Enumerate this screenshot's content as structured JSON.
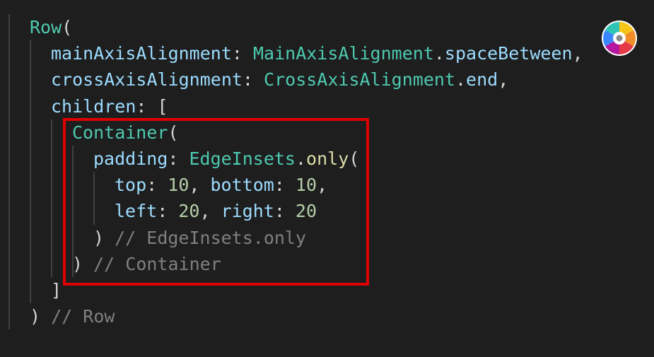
{
  "editor": {
    "background": "#1e1e1e",
    "token_colors": {
      "class": "#4ec9b0",
      "property": "#9cdcfe",
      "function": "#dcdcaa",
      "number": "#b5cea8",
      "punctuation": "#d4d4d4",
      "comment": "#808080",
      "bracket": "#ffd700"
    },
    "lines": [
      {
        "indent": 0,
        "tokens": [
          {
            "t": "Row",
            "k": "class"
          },
          {
            "t": "(",
            "k": "punctuation"
          }
        ]
      },
      {
        "indent": 1,
        "tokens": [
          {
            "t": "mainAxisAlignment",
            "k": "property"
          },
          {
            "t": ": ",
            "k": "punctuation"
          },
          {
            "t": "MainAxisAlignment",
            "k": "class"
          },
          {
            "t": ".",
            "k": "punctuation"
          },
          {
            "t": "spaceBetween",
            "k": "property"
          },
          {
            "t": ",",
            "k": "punctuation"
          }
        ]
      },
      {
        "indent": 1,
        "tokens": [
          {
            "t": "crossAxisAlignment",
            "k": "property"
          },
          {
            "t": ": ",
            "k": "punctuation"
          },
          {
            "t": "CrossAxisAlignment",
            "k": "class"
          },
          {
            "t": ".",
            "k": "punctuation"
          },
          {
            "t": "end",
            "k": "property"
          },
          {
            "t": ",",
            "k": "punctuation"
          }
        ]
      },
      {
        "indent": 1,
        "tokens": [
          {
            "t": "children",
            "k": "property"
          },
          {
            "t": ": [",
            "k": "punctuation"
          }
        ]
      },
      {
        "indent": 2,
        "tokens": [
          {
            "t": "Container",
            "k": "class"
          },
          {
            "t": "(",
            "k": "punctuation"
          }
        ]
      },
      {
        "indent": 3,
        "tokens": [
          {
            "t": "padding",
            "k": "property"
          },
          {
            "t": ": ",
            "k": "punctuation"
          },
          {
            "t": "EdgeInsets",
            "k": "class"
          },
          {
            "t": ".",
            "k": "punctuation"
          },
          {
            "t": "only",
            "k": "function"
          },
          {
            "t": "(",
            "k": "punctuation"
          }
        ]
      },
      {
        "indent": 4,
        "tokens": [
          {
            "t": "top",
            "k": "property"
          },
          {
            "t": ": ",
            "k": "punctuation"
          },
          {
            "t": "10",
            "k": "number"
          },
          {
            "t": ", ",
            "k": "punctuation"
          },
          {
            "t": "bottom",
            "k": "property"
          },
          {
            "t": ": ",
            "k": "punctuation"
          },
          {
            "t": "10",
            "k": "number"
          },
          {
            "t": ",",
            "k": "punctuation"
          }
        ]
      },
      {
        "indent": 4,
        "tokens": [
          {
            "t": "left",
            "k": "property"
          },
          {
            "t": ": ",
            "k": "punctuation"
          },
          {
            "t": "20",
            "k": "number"
          },
          {
            "t": ", ",
            "k": "punctuation"
          },
          {
            "t": "right",
            "k": "property"
          },
          {
            "t": ": ",
            "k": "punctuation"
          },
          {
            "t": "20",
            "k": "number"
          }
        ]
      },
      {
        "indent": 3,
        "tokens": [
          {
            "t": ") ",
            "k": "punctuation"
          },
          {
            "t": "// EdgeInsets.only",
            "k": "comment"
          }
        ]
      },
      {
        "indent": 2,
        "tokens": [
          {
            "t": ") ",
            "k": "punctuation"
          },
          {
            "t": "// Container",
            "k": "comment"
          }
        ]
      },
      {
        "indent": 1,
        "tokens": [
          {
            "t": "]",
            "k": "punctuation"
          }
        ]
      },
      {
        "indent": 0,
        "tokens": [
          {
            "t": ") ",
            "k": "punctuation"
          },
          {
            "t": "// Row",
            "k": "comment"
          }
        ]
      }
    ],
    "highlight_color": "#e00000",
    "color_wheel_icon": "color-wheel-icon"
  }
}
